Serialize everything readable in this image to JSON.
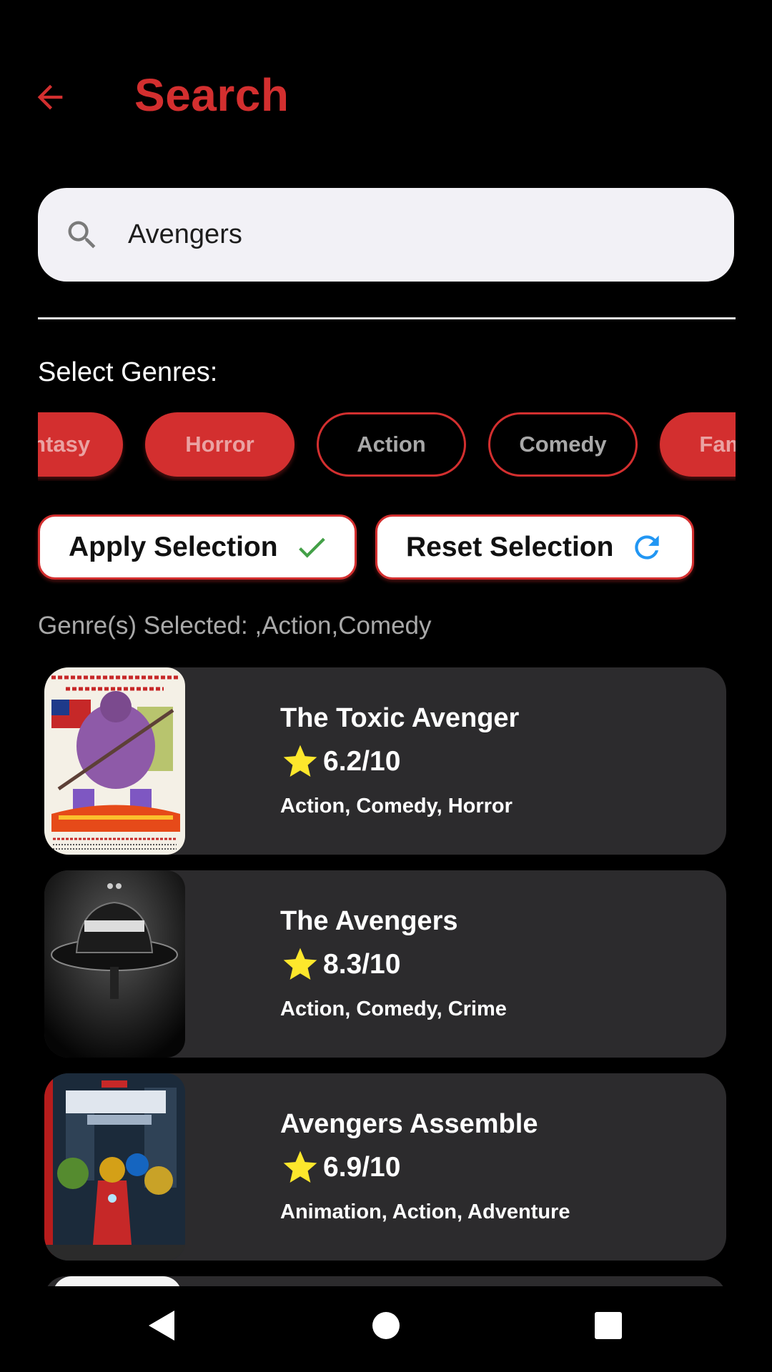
{
  "header": {
    "title": "Search",
    "back_icon": "arrow-left-icon"
  },
  "search": {
    "value": "Avengers",
    "icon": "search-icon"
  },
  "genres": {
    "label": "Select Genres:",
    "chips": [
      {
        "label": "Fantasy",
        "selected": true
      },
      {
        "label": "Horror",
        "selected": true
      },
      {
        "label": "Action",
        "selected": false
      },
      {
        "label": "Comedy",
        "selected": false
      },
      {
        "label": "Family",
        "selected": true
      }
    ]
  },
  "actions": {
    "apply_label": "Apply Selection",
    "apply_icon": "checkmark-icon",
    "reset_label": "Reset Selection",
    "reset_icon": "refresh-icon"
  },
  "selected_text": "Genre(s) Selected: ,Action,Comedy",
  "movies": [
    {
      "title": "The Toxic Avenger",
      "rating": "6.2/10",
      "genres": "Action, Comedy, Horror"
    },
    {
      "title": "The Avengers",
      "rating": "8.3/10",
      "genres": "Action, Comedy, Crime"
    },
    {
      "title": "Avengers Assemble",
      "rating": "6.9/10",
      "genres": "Animation, Action, Adventure"
    }
  ],
  "colors": {
    "accent": "#d32f2f",
    "card": "#2c2b2d",
    "star": "#fde72c",
    "check": "#43a047",
    "refresh": "#2196f3"
  },
  "navbar": {
    "icons": [
      "back-triangle-icon",
      "home-circle-icon",
      "recents-square-icon"
    ]
  }
}
